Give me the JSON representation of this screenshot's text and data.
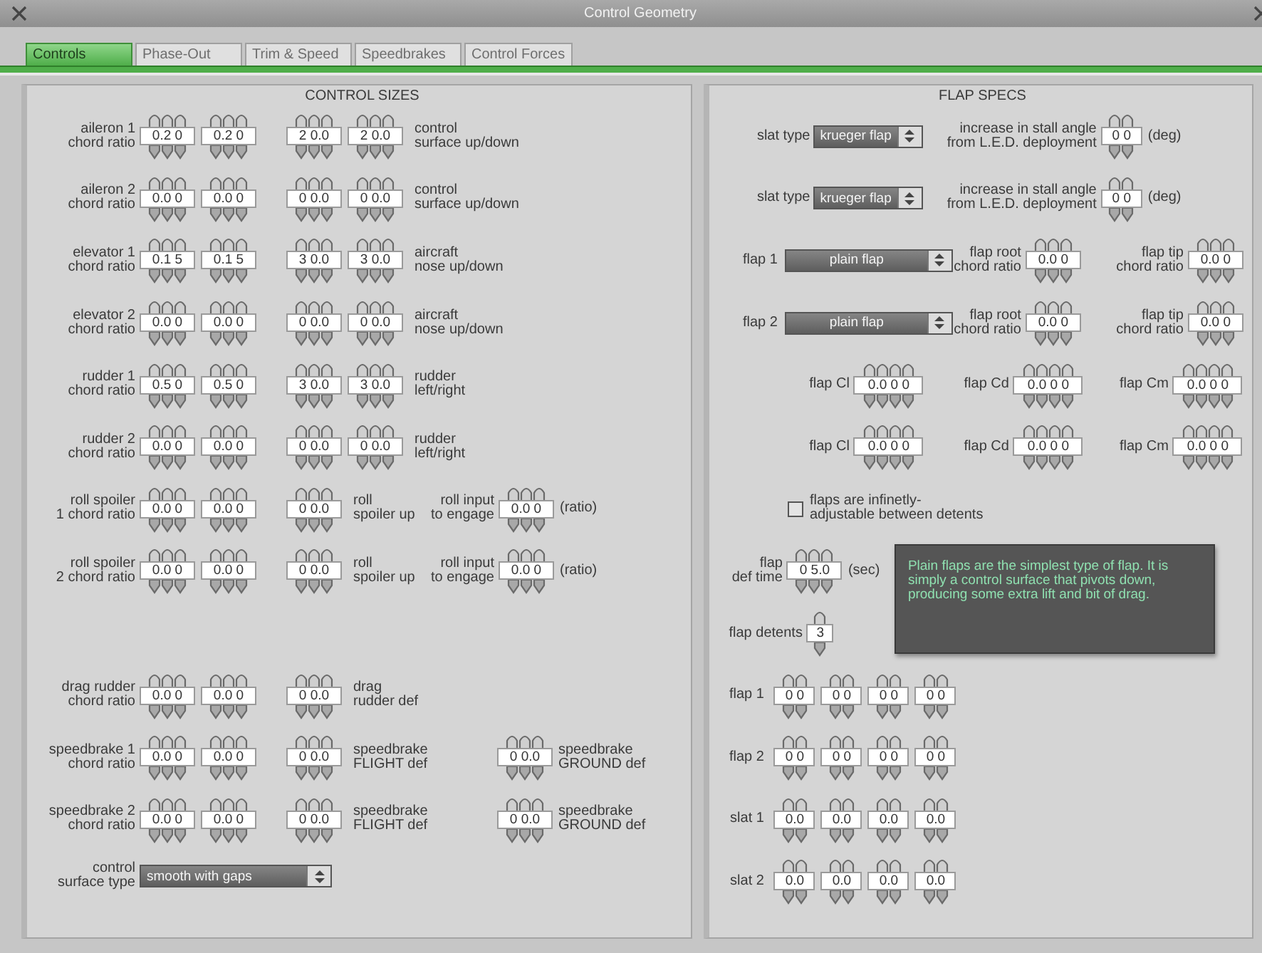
{
  "window": {
    "title": "Control Geometry"
  },
  "tabs": [
    {
      "label": "Controls",
      "selected": true
    },
    {
      "label": "Phase-Out",
      "selected": false
    },
    {
      "label": "Trim & Speed",
      "selected": false
    },
    {
      "label": "Speedbrakes",
      "selected": false
    },
    {
      "label": "Control Forces",
      "selected": false
    }
  ],
  "control_sizes": {
    "title": "CONTROL SIZES",
    "upper_rows": [
      {
        "label": "aileron 1\nchord ratio",
        "chord": [
          "0.2 0",
          "0.2 0"
        ],
        "deflection": [
          "2 0.0",
          "2 0.0"
        ],
        "deflection_label": "control\nsurface up/down"
      },
      {
        "label": "aileron 2\nchord ratio",
        "chord": [
          "0.0 0",
          "0.0 0"
        ],
        "deflection": [
          "0 0.0",
          "0 0.0"
        ],
        "deflection_label": "control\nsurface up/down"
      },
      {
        "label": "elevator 1\nchord ratio",
        "chord": [
          "0.1 5",
          "0.1 5"
        ],
        "deflection": [
          "3 0.0",
          "3 0.0"
        ],
        "deflection_label": "aircraft\nnose up/down"
      },
      {
        "label": "elevator 2\nchord ratio",
        "chord": [
          "0.0 0",
          "0.0 0"
        ],
        "deflection": [
          "0 0.0",
          "0 0.0"
        ],
        "deflection_label": "aircraft\nnose up/down"
      },
      {
        "label": "rudder 1\nchord ratio",
        "chord": [
          "0.5 0",
          "0.5 0"
        ],
        "deflection": [
          "3 0.0",
          "3 0.0"
        ],
        "deflection_label": "rudder\nleft/right"
      },
      {
        "label": "rudder 2\nchord ratio",
        "chord": [
          "0.0 0",
          "0.0 0"
        ],
        "deflection": [
          "0 0.0",
          "0 0.0"
        ],
        "deflection_label": "rudder\nleft/right"
      },
      {
        "label": "roll spoiler\n1 chord ratio",
        "chord": [
          "0.0 0",
          "0.0 0"
        ],
        "deflection": [
          "0 0.0"
        ],
        "deflection_label": "roll\nspoiler up",
        "engage": {
          "label": "roll input\nto engage",
          "value": "0.0 0",
          "unit": "(ratio)"
        }
      },
      {
        "label": "roll spoiler\n2 chord ratio",
        "chord": [
          "0.0 0",
          "0.0 0"
        ],
        "deflection": [
          "0 0.0"
        ],
        "deflection_label": "roll\nspoiler up",
        "engage": {
          "label": "roll input\nto engage",
          "value": "0.0 0",
          "unit": "(ratio)"
        }
      }
    ],
    "lower_rows": [
      {
        "label": "drag rudder\nchord ratio",
        "chord": [
          "0.0 0",
          "0.0 0"
        ],
        "deflection": [
          "0 0.0"
        ],
        "deflection_label": "drag\nrudder def"
      },
      {
        "label": "speedbrake 1\nchord ratio",
        "chord": [
          "0.0 0",
          "0.0 0"
        ],
        "deflection": [
          "0 0.0"
        ],
        "deflection_label": "speedbrake\nFLIGHT def",
        "ground": {
          "value": "0 0.0",
          "label": "speedbrake\nGROUND def"
        }
      },
      {
        "label": "speedbrake 2\nchord ratio",
        "chord": [
          "0.0 0",
          "0.0 0"
        ],
        "deflection": [
          "0 0.0"
        ],
        "deflection_label": "speedbrake\nFLIGHT def",
        "ground": {
          "value": "0 0.0",
          "label": "speedbrake\nGROUND def"
        }
      }
    ],
    "surface_type": {
      "label": "control\nsurface type",
      "value": "smooth with gaps"
    }
  },
  "flap_specs": {
    "title": "FLAP SPECS",
    "slats": [
      {
        "label": "slat type",
        "value": "krueger flap",
        "stall_label": "increase in stall angle\nfrom L.E.D. deployment",
        "stall_value": "0 0",
        "unit": "(deg)"
      },
      {
        "label": "slat type",
        "value": "krueger flap",
        "stall_label": "increase in stall angle\nfrom L.E.D. deployment",
        "stall_value": "0 0",
        "unit": "(deg)"
      }
    ],
    "flaps": [
      {
        "label": "flap 1",
        "type": "plain flap",
        "root_label": "flap root\nchord ratio",
        "root_value": "0.0 0",
        "tip_label": "flap tip\nchord ratio",
        "tip_value": "0.0 0"
      },
      {
        "label": "flap 2",
        "type": "plain flap",
        "root_label": "flap root\nchord ratio",
        "root_value": "0.0 0",
        "tip_label": "flap tip\nchord ratio",
        "tip_value": "0.0 0"
      }
    ],
    "coefficients": [
      {
        "items": [
          {
            "label": "flap Cl",
            "value": "0.0 0 0"
          },
          {
            "label": "flap Cd",
            "value": "0.0 0 0"
          },
          {
            "label": "flap Cm",
            "value": "0.0 0 0"
          }
        ]
      },
      {
        "items": [
          {
            "label": "flap Cl",
            "value": "0.0 0 0"
          },
          {
            "label": "flap Cd",
            "value": "0.0 0 0"
          },
          {
            "label": "flap Cm",
            "value": "0.0 0 0"
          }
        ]
      }
    ],
    "infinite_detents": {
      "label": "flaps are infinetly-\nadjustable between detents",
      "checked": false
    },
    "def_time": {
      "label": "flap\ndef time",
      "value": "0 5.0",
      "unit": "(sec)"
    },
    "detents": {
      "label": "flap detents",
      "value": "3"
    },
    "tooltip": "Plain flaps are the simplest type of flap. It is simply a control surface that pivots down, producing some extra lift and bit of drag.",
    "detent_rows": [
      {
        "label": "flap 1",
        "values": [
          "0 0",
          "0 0",
          "0 0",
          "0 0"
        ]
      },
      {
        "label": "flap 2",
        "values": [
          "0 0",
          "0 0",
          "0 0",
          "0 0"
        ]
      },
      {
        "label": "slat 1",
        "values": [
          "0.0",
          "0.0",
          "0.0",
          "0.0"
        ]
      },
      {
        "label": "slat 2",
        "values": [
          "0.0",
          "0.0",
          "0.0",
          "0.0"
        ]
      }
    ]
  }
}
